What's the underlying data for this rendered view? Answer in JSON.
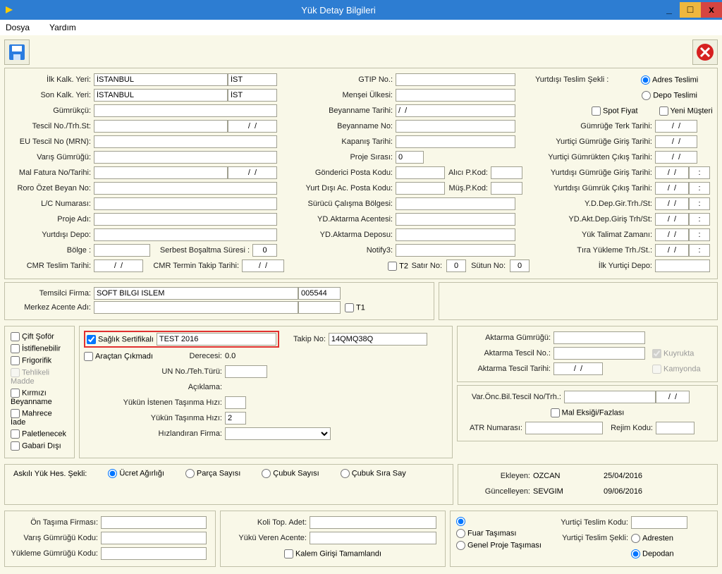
{
  "window": {
    "title": "Yük Detay Bilgileri"
  },
  "menu": {
    "file": "Dosya",
    "help": "Yardım"
  },
  "top": {
    "ilkKalkYeri": "İlk Kalk. Yeri:",
    "ilkKalkYeriVal": "İSTANBUL",
    "ilkKalkCode": "İST",
    "sonKalkYeri": "Son Kalk. Yeri:",
    "sonKalkYeriVal": "İSTANBUL",
    "sonKalkCode": "İST",
    "gumrukcu": "Gümrükçü:",
    "tescilNo": "Tescil No./Trh.St:",
    "tescilNoDate": "/  /",
    "euTescil": "EU Tescil No (MRN):",
    "varisGumrugu": "Varış Gümrüğü:",
    "malFatura": "Mal Fatura No/Tarihi:",
    "malFaturaDate": "/  /",
    "roroOzet": "Roro Özet Beyan No:",
    "lcNumarasi": "L/C Numarası:",
    "projeAdi": "Proje Adı:",
    "yurtdisiDepo": "Yurtdışı Depo:",
    "bolge": "Bölge :",
    "serbestBosaltma": "Serbest Boşaltma Süresi :",
    "serbestBosaltmaVal": "0",
    "cmrTeslim": "CMR Teslim Tarihi:",
    "cmrTeslimDate": "/  /",
    "cmrTermin": "CMR Termin Takip Tarihi:",
    "cmrTerminDate": "/  /",
    "gtipNo": "GTIP No.:",
    "menseiUlkesi": "Menşei Ülkesi:",
    "beyannameTarihi": "Beyanname Tarihi:",
    "beyannameTarihiVal": "/  /",
    "beyannameNo": "Beyanname No:",
    "kapanisTarihi": "Kapanış Tarihi:",
    "projeSirasi": "Proje Sırası:",
    "projeSirasiVal": "0",
    "gondericiPosta": "Gönderici Posta Kodu:",
    "aliciPKod": "Alıcı P.Kod:",
    "yurtDisiAc": "Yurt Dışı Ac. Posta Kodu:",
    "musPKod": "Müş.P.Kod:",
    "surucuBolge": "Sürücü Çalışma Bölgesi:",
    "ydAktarmaAcente": "YD.Aktarma Acentesi:",
    "ydAktarmaDepo": "YD.Aktarma Deposu:",
    "notify3": "Notify3:",
    "t2": "T2",
    "satirNo": "Satır No:",
    "satirNoVal": "0",
    "sutunNo": "Sütun No:",
    "sutunNoVal": "0",
    "yurtdisiTeslimSekli": "Yurtdışı Teslim Şekli :",
    "adresTeslimi": "Adres Teslimi",
    "depoTeslimi": "Depo Teslimi",
    "spotFiyat": "Spot Fiyat",
    "yeniMusteri": "Yeni Müşteri",
    "gumrugeTerkTarihi": "Gümrüğe Terk Tarihi:",
    "gumrugeTerkTarihiVal": "/  /",
    "yurticiGumrugeGiris": "Yurtiçi Gümrüğe Giriş Tarihi:",
    "yurticiGumrugeGirisVal": "/  /",
    "yurticiGumruktenCikis": "Yurtiçi Gümrükten Çıkış Tarihi:",
    "yurticiGumruktenCikisVal": "/  /",
    "yurtdisiGumrugeGiris": "Yurtdışı Gümrüğe Giriş Tarihi:",
    "yurtdisiGumrugeGirisVal": "/  /",
    "colon": ":",
    "yurtdisiGumrukCikis": "Yurtdışı Gümrük Çıkış Tarihi:",
    "yurtdisiGumrukCikisVal": "/  /",
    "ydDepGir": "Y.D.Dep.Gir.Trh./St:",
    "ydDepGirVal": "/  /",
    "ydAktDepGiris": "YD.Akt.Dep.Giriş Trh/St:",
    "ydAktDepGirisVal": "/  /",
    "yukTalimat": "Yük Talimat Zamanı:",
    "yukTalimatVal": "/  /",
    "tiraYukleme": "Tıra Yükleme Trh./St.:",
    "tiraYuklemeVal": "/  /",
    "ilkYurticiDepo": "İlk Yurtiçi Depo:"
  },
  "agent": {
    "temsilciFirma": "Temsilci Firma:",
    "temsilciFirmaVal": "SOFT BILGI ISLEM",
    "temsilciFirmaCode": "005544",
    "merkezAcente": "Merkez Acente Adı:",
    "t1": "T1"
  },
  "mid": {
    "ciftSofor": "Çift Şoför",
    "istiflenebilir": "İstiflenebilir",
    "frigorifik": "Frigorifik",
    "tehlikeliMadde": "Tehlikeli Madde",
    "kirmiziBeyanname": "Kırmızı Beyanname",
    "mahreceIade": "Mahrece İade",
    "paletlenecek": "Paletlenecek",
    "gabariDisi": "Gabari Dışı",
    "saglikSertifika": "Sağlık Sertifikalı",
    "saglikVal": "TEST 2016",
    "takipNo": "Takip No:",
    "takipNoVal": "14QMQ38Q",
    "aractanCikmadi": "Araçtan Çıkmadı",
    "derecesi": "Derecesi:",
    "derecesiVal": "0.0",
    "unNo": "UN No./Teh.Türü:",
    "aciklama": "Açıklama:",
    "yukunIstenen": "Yükün İstenen Taşınma Hızı:",
    "yukunTasinma": "Yükün Taşınma Hızı:",
    "yukunTasinmaVal": "2",
    "hizlandiranFirma": "Hızlandıran Firma:",
    "aktarmaGumrugu": "Aktarma Gümrüğü:",
    "aktarmaTescilNo": "Aktarma Tescil No.:",
    "aktarmaTescilTarihi": "Aktarma Tescil Tarihi:",
    "aktarmaTescilTarihiVal": "/  /",
    "kuyrukta": "Kuyrukta",
    "kamyonda": "Kamyonda",
    "varOncBil": "Var.Önc.Bil.Tescil No/Trh.:",
    "varOncBilDate": "/  /",
    "malEksigi": "Mal Eksiği/Fazlası",
    "atrNumarasi": "ATR Numarası:",
    "rejimKodu": "Rejim Kodu:"
  },
  "askili": {
    "label": "Askılı Yük Hes. Şekli:",
    "ucretAgirligi": "Ücret Ağırlığı",
    "parcaSayisi": "Parça Sayısı",
    "cubukSayisi": "Çubuk Sayısı",
    "cubukSiraSay": "Çubuk Sıra Say",
    "ekleyen": "Ekleyen:",
    "ekleyenVal": "OZCAN",
    "ekleyenDate": "25/04/2016",
    "guncelleyen": "Güncelleyen:",
    "guncelleyenVal": "SEVGIM",
    "guncelleyenDate": "09/06/2016"
  },
  "bottom": {
    "onTasima": "Ön Taşıma Firması:",
    "varisGumruguKodu": "Varış Gümrüğü Kodu:",
    "yuklemeGumrugu": "Yükleme Gümrüğü Kodu:",
    "koliTopAdet": "Koli Top. Adet:",
    "yukuVerenAcente": "Yükü Veren Acente:",
    "kalemGirisi": "Kalem Girişi Tamamlandı",
    "fuarTasimasi": "Fuar Taşıması",
    "genelProje": "Genel Proje Taşıması",
    "yurticiTeslimKodu": "Yurtiçi Teslim Kodu:",
    "yurticiTeslimSekli": "Yurtiçi Teslim Şekli:",
    "adresten": "Adresten",
    "depodan": "Depodan"
  }
}
